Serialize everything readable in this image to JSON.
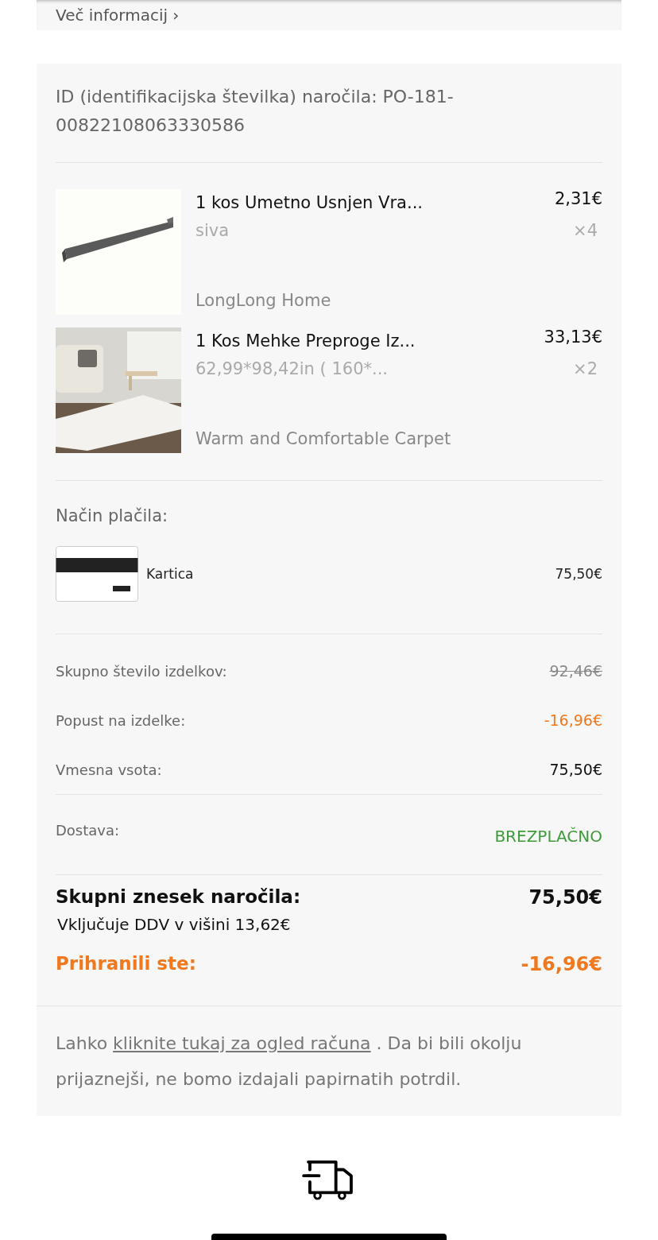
{
  "top_card": {
    "link": "Več informacij ›"
  },
  "order": {
    "id_text": "ID (identifikacijska številka) naročila: PO-181-00822108063330586",
    "items": [
      {
        "kind": "picture",
        "title": "1 kos Umetno Usnjen Vra...",
        "variant": "siva",
        "price": "2,31€",
        "qty": "×4",
        "store": "LongLong Home"
      },
      {
        "kind": "picture",
        "title": "1 Kos Mehke Preproge Iz...",
        "variant": "62,99*98,42in ( 160*...",
        "price": "33,13€",
        "qty": "×2",
        "store": "Warm and Comfortable Carpet"
      }
    ],
    "payment": {
      "label": "Način plačila:",
      "method": "Kartica",
      "amount": "75,50€"
    },
    "summary": [
      {
        "label": "Skupno število izdelkov:",
        "value": "92,46€",
        "kind": "struck"
      },
      {
        "label": "Popust na izdelke:",
        "value": "-16,96€",
        "kind": "discount"
      },
      {
        "label": "Vmesna vsota:",
        "value": "75,50€",
        "kind": "plain"
      }
    ],
    "shipping": {
      "label": "Dostava:",
      "value": "BREZPLAČNO"
    },
    "total": {
      "label": "Skupni znesek naročila:",
      "value": "75,50€",
      "vat": "Vključuje DDV v višini 13,62€"
    },
    "saved": {
      "label": "Prihranili ste:",
      "value": "-16,96€"
    },
    "note": {
      "before": "Lahko ",
      "link": "kliknite tukaj za ogled računa",
      "after": " . Da bi bili okolju prijaznejši, ne bomo izdajali papirnatih potrdil."
    }
  }
}
